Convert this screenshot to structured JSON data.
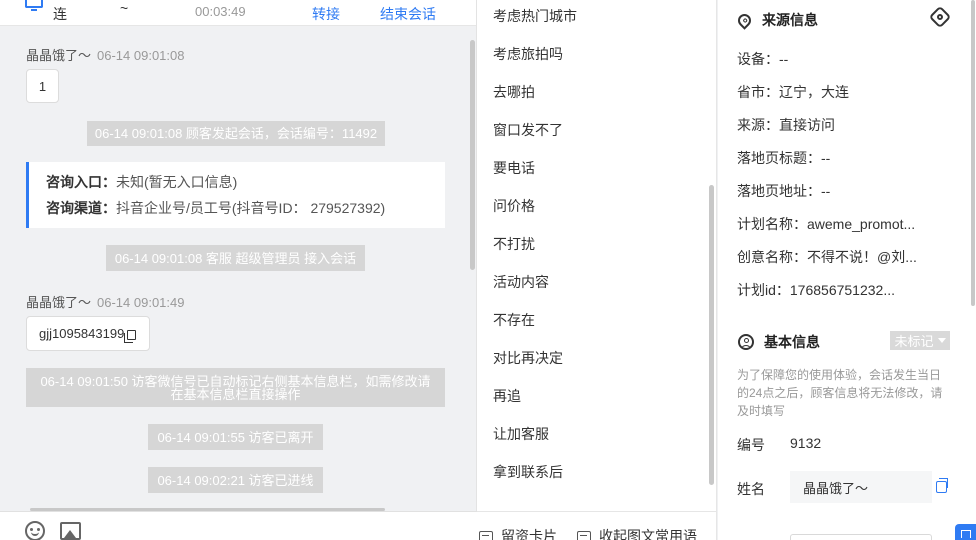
{
  "session_header": {
    "location": "连",
    "separator": "~",
    "duration": "00:03:49",
    "transfer_label": "转接",
    "end_label": "结束会话"
  },
  "chat": {
    "messages": [
      {
        "sender": "晶晶饿了～",
        "time": "06-14 09:01:08",
        "content": "1"
      },
      {
        "system": "06-14 09:01:08 顾客发起会话，会话编号：11492"
      },
      {
        "card": {
          "entry_label": "咨询入口：",
          "entry_value": "未知(暂无入口信息)",
          "channel_label": "咨询渠道：",
          "channel_value": "抖音企业号/员工号(抖音号ID： 279527392)"
        }
      },
      {
        "system": "06-14 09:01:08 客服 超级管理员 接入会话"
      },
      {
        "sender": "晶晶饿了～",
        "time": "06-14 09:01:49",
        "content": "gjj1095843199"
      },
      {
        "system": "06-14 09:01:50 访客微信号已自动标记右侧基本信息栏，如需修改请在基本信息栏直接操作"
      },
      {
        "system": "06-14 09:01:55 访客已离开"
      },
      {
        "system": "06-14 09:02:21 访客已进线"
      }
    ]
  },
  "quick_replies": {
    "items": [
      "考虑热门城市",
      "考虑旅拍吗",
      "去哪拍",
      "窗口发不了",
      "要电话",
      "问价格",
      "不打扰",
      "活动内容",
      "不存在",
      "对比再决定",
      "再追",
      "让加客服",
      "拿到联系后"
    ],
    "toolbar": {
      "lead_card_label": "留资卡片",
      "collapse_label": "收起图文常用语"
    }
  },
  "info_panel": {
    "source_title": "来源信息",
    "source_fields": [
      "设备：--",
      "省市：辽宁，大连",
      "来源：直接访问",
      "落地页标题：--",
      "落地页地址：--",
      "计划名称：aweme_promot...",
      "创意名称：不得不说！@刘...",
      "计划id：176856751232..."
    ],
    "basic_title": "基本信息",
    "tag_status": "未标记",
    "notice": "为了保障您的使用体验，会话发生当日的24点之后，顾客信息将无法修改，请及时填写",
    "id_label": "编号",
    "id_value": "9132",
    "name_label": "姓名",
    "name_value": "晶晶饿了～"
  },
  "colors": {
    "accent": "#2f7bf3",
    "system_msg_bg": "#d6d6d6",
    "chat_bg": "#f0f1f3"
  }
}
